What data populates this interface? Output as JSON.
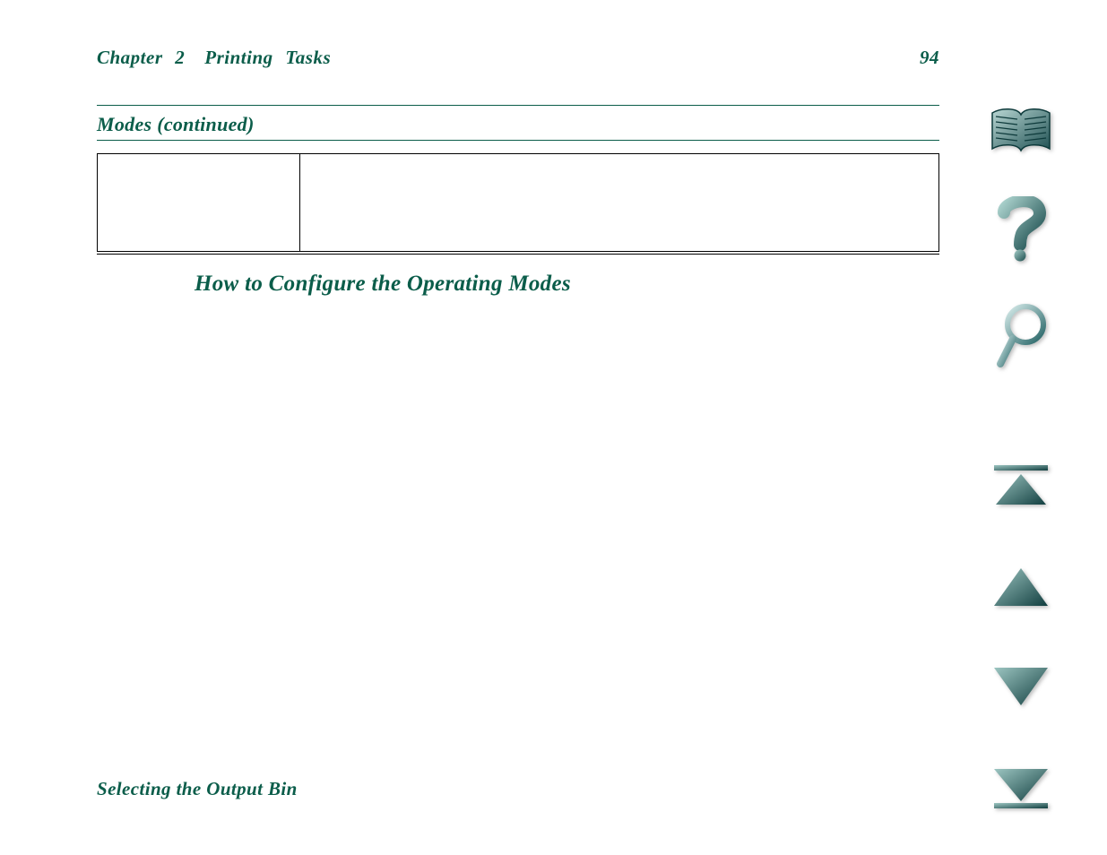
{
  "header": {
    "chapter": "Chapter 2",
    "chapter_title": "Printing Tasks",
    "page_number": "94"
  },
  "table": {
    "title": "Modes (continued)"
  },
  "section": {
    "heading": "How to Configure the Operating Modes"
  },
  "footer": {
    "text": "Selecting the Output Bin"
  },
  "nav": {
    "book": "book-icon",
    "help": "help-icon",
    "search": "search-icon",
    "first": "first-page-icon",
    "prev": "prev-page-icon",
    "next": "next-page-icon",
    "last": "last-page-icon"
  },
  "colors": {
    "accent": "#0b5d4a",
    "icon_fill": "#2e6668"
  }
}
